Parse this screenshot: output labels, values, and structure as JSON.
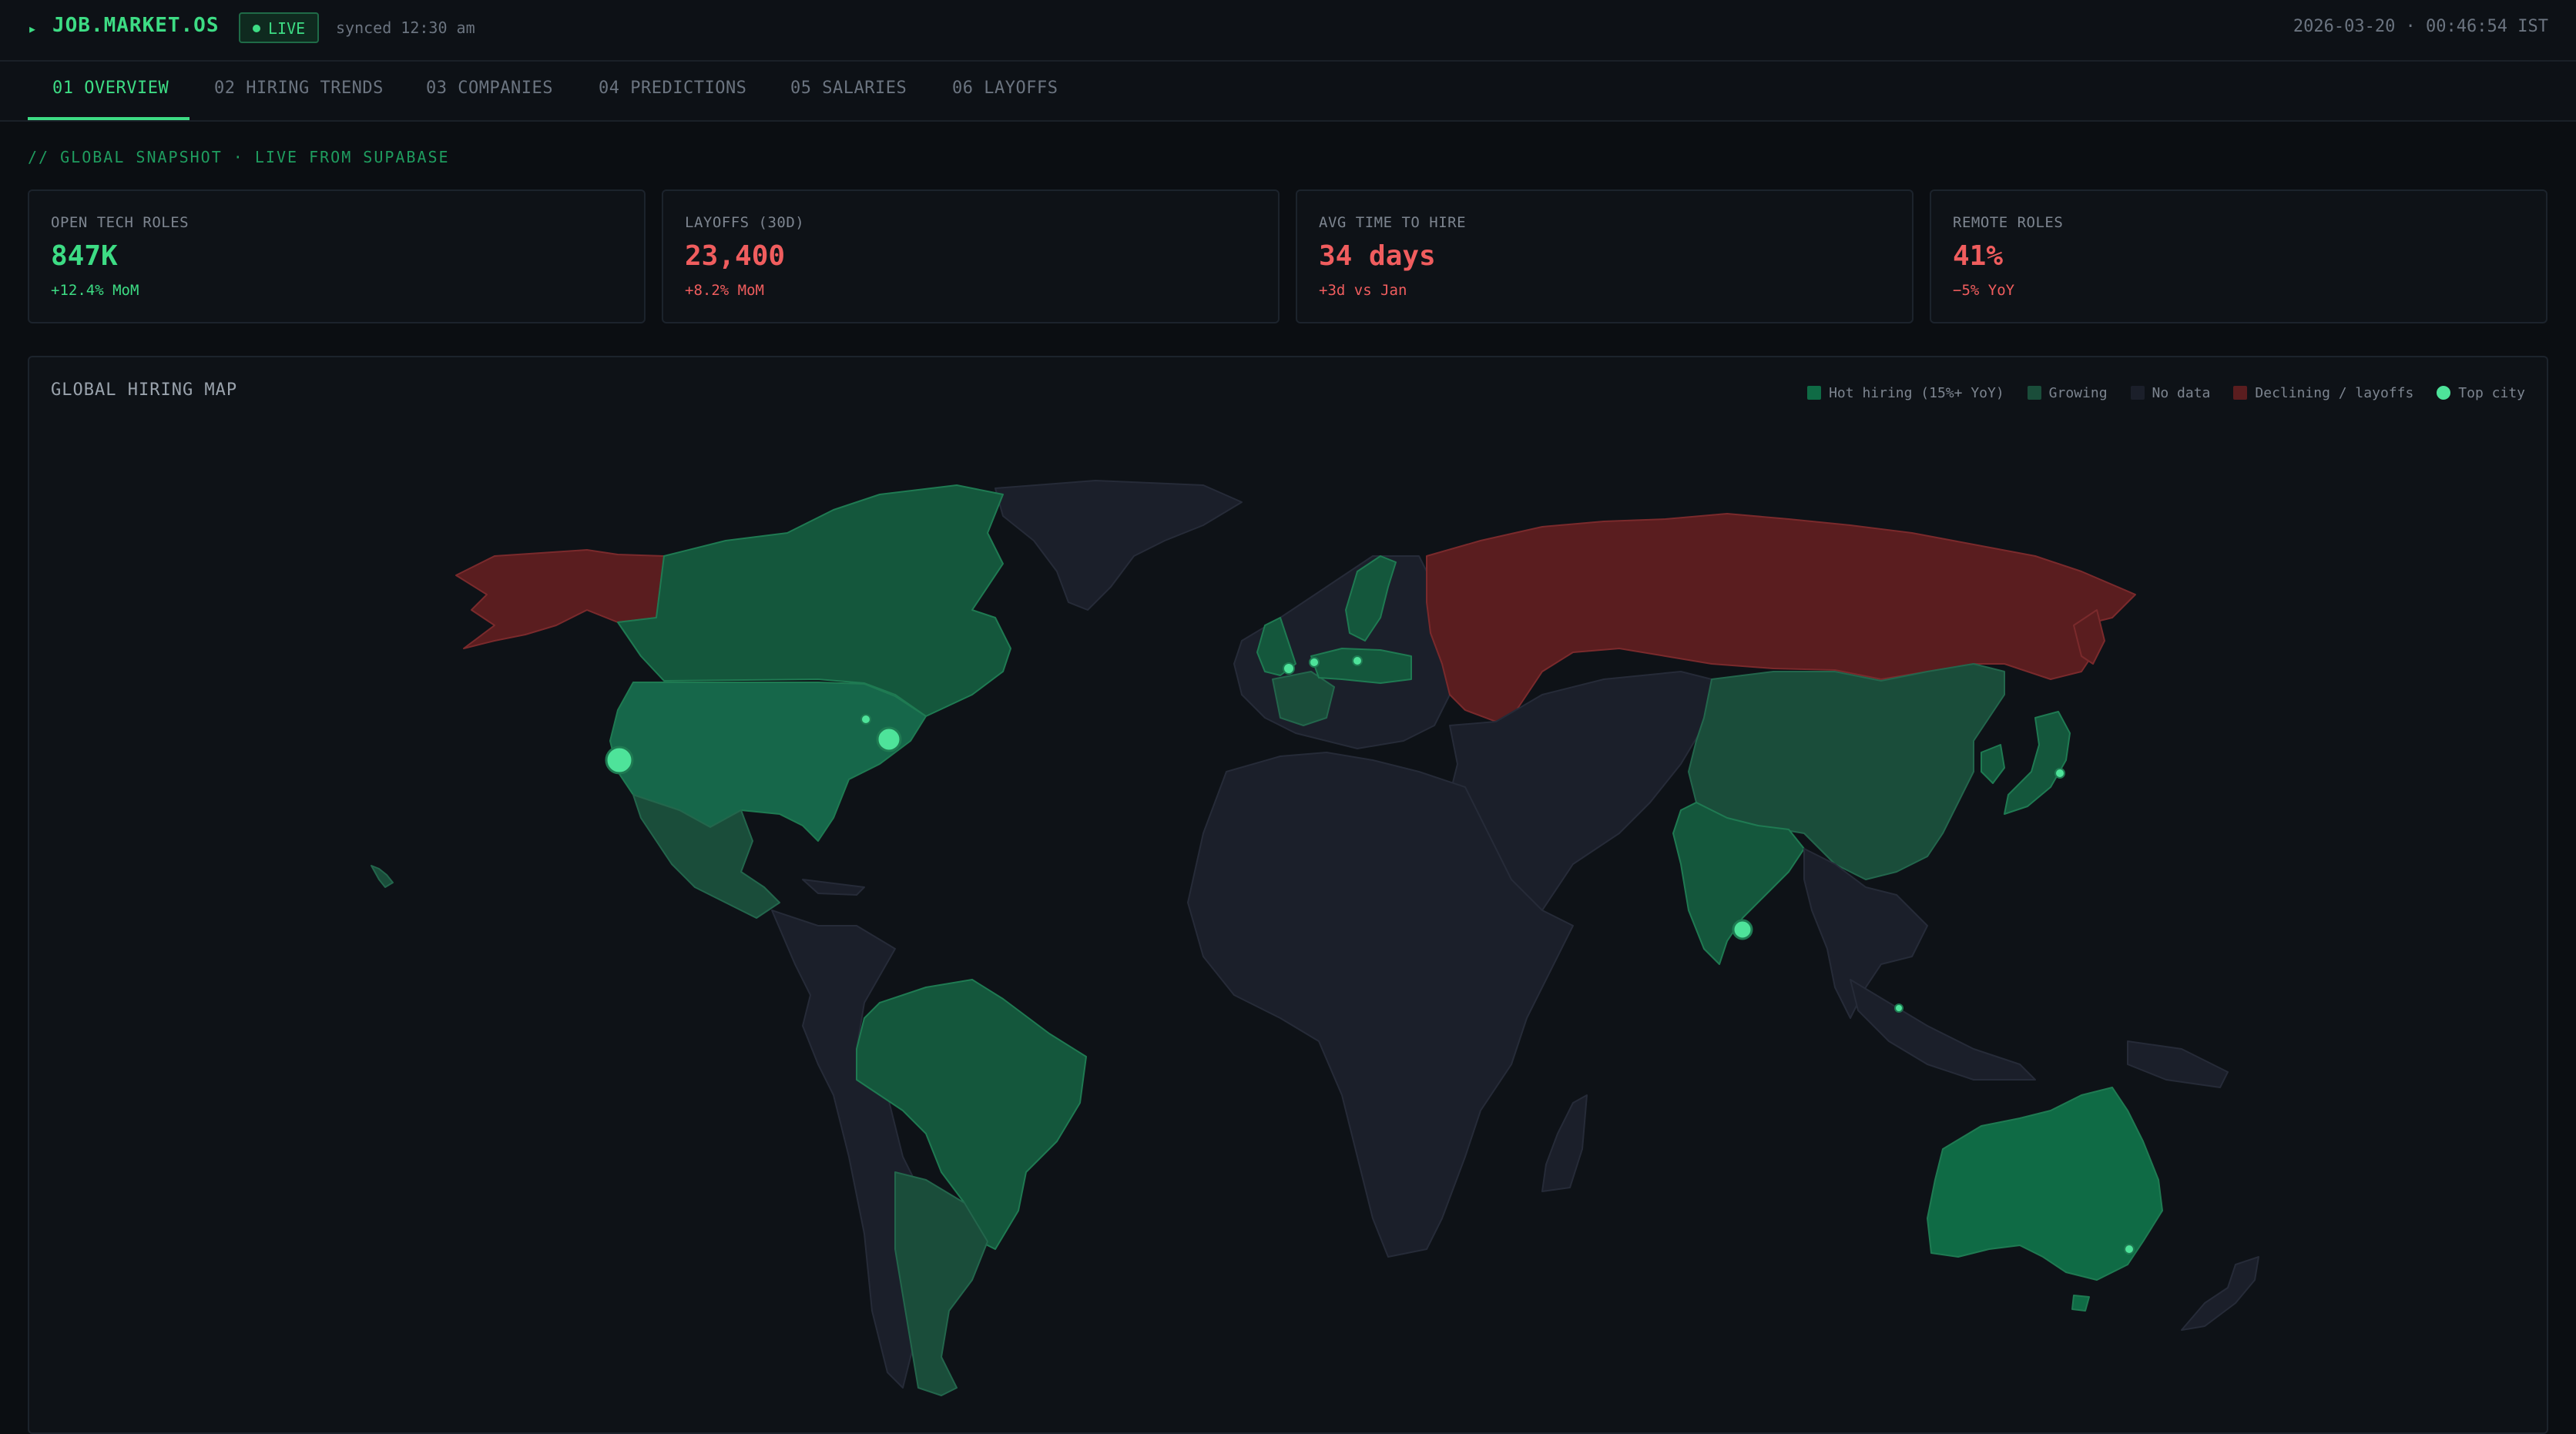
{
  "header": {
    "brand_glyph": "▸",
    "brand": "JOB.MARKET.OS",
    "live_label": "LIVE",
    "synced": "synced 12:30 am",
    "datetime": "2026-03-20 · 00:46:54 IST"
  },
  "tabs": [
    {
      "label": "01 OVERVIEW",
      "active": true
    },
    {
      "label": "02 HIRING TRENDS"
    },
    {
      "label": "03 COMPANIES"
    },
    {
      "label": "04 PREDICTIONS"
    },
    {
      "label": "05 SALARIES"
    },
    {
      "label": "06 LAYOFFS"
    }
  ],
  "section_label": "// GLOBAL SNAPSHOT · LIVE FROM SUPABASE",
  "kpis": [
    {
      "label": "OPEN TECH ROLES",
      "value": "847K",
      "change": "+12.4% MoM",
      "color": "#3ddc84"
    },
    {
      "label": "LAYOFFS (30D)",
      "value": "23,400",
      "change": "+8.2% MoM",
      "color": "#f05d5e"
    },
    {
      "label": "AVG TIME TO HIRE",
      "value": "34 days",
      "change": "+3d vs Jan",
      "color": "#f05d5e"
    },
    {
      "label": "REMOTE ROLES",
      "value": "41%",
      "change": "−5% YoY",
      "color": "#f05d5e"
    }
  ],
  "map": {
    "title": "GLOBAL HIRING MAP",
    "legend": [
      {
        "label": "Hot hiring (15%+ YoY)",
        "color": "#0f6b45",
        "icon": "square"
      },
      {
        "label": "Growing",
        "color": "#1a4d3a",
        "icon": "square"
      },
      {
        "label": "No data",
        "color": "#1b1f2a",
        "icon": "square"
      },
      {
        "label": "Declining / layoffs",
        "color": "#5a1d1f",
        "icon": "square"
      },
      {
        "label": "Top city",
        "color": "#4ee39a",
        "icon": "dot"
      }
    ]
  }
}
